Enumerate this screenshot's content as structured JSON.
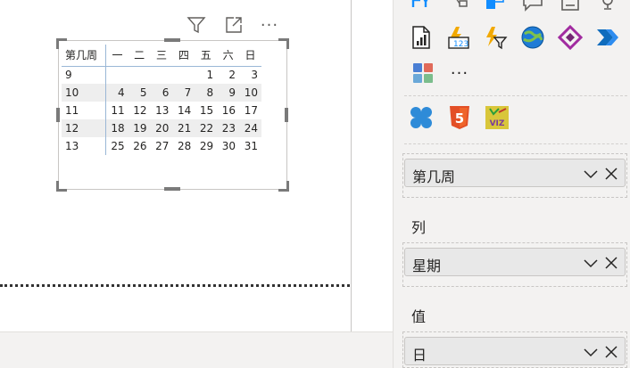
{
  "visual_header": {
    "filter_icon": "filter-icon",
    "focus_icon": "focus-mode-icon",
    "more_icon": "more-options-icon",
    "more_glyph": "···"
  },
  "calendar": {
    "headers": [
      "第几周",
      "一",
      "二",
      "三",
      "四",
      "五",
      "六",
      "日"
    ],
    "rows": [
      [
        "9",
        "",
        "",
        "",
        "",
        "1",
        "2",
        "3"
      ],
      [
        "10",
        "4",
        "5",
        "6",
        "7",
        "8",
        "9",
        "10"
      ],
      [
        "11",
        "11",
        "12",
        "13",
        "14",
        "15",
        "16",
        "17"
      ],
      [
        "12",
        "18",
        "19",
        "20",
        "21",
        "22",
        "23",
        "24"
      ],
      [
        "13",
        "25",
        "26",
        "27",
        "28",
        "29",
        "30",
        "31"
      ]
    ]
  },
  "visualizations": {
    "more_glyph": "···",
    "icons": [
      "paginated-report-icon",
      "power-apps-icon",
      "power-automate-icon",
      "arcgis-globe-icon",
      "power-apps-diamond-icon",
      "power-automate-arrow-icon",
      "matrix-tiles-icon",
      "custom-visual-icon",
      "html5-icon",
      "pviz-icon"
    ],
    "html5_text": "5",
    "pviz_text": "VIZ"
  },
  "fields": {
    "rows_pill": "第几周",
    "columns_label": "列",
    "columns_pill": "星期",
    "values_label": "值",
    "values_pill": "日"
  },
  "colors": {
    "accent": "#118dff",
    "header_border": "#9ab7d6",
    "alt_row": "#eeeeee",
    "html5": "#e34f26"
  }
}
